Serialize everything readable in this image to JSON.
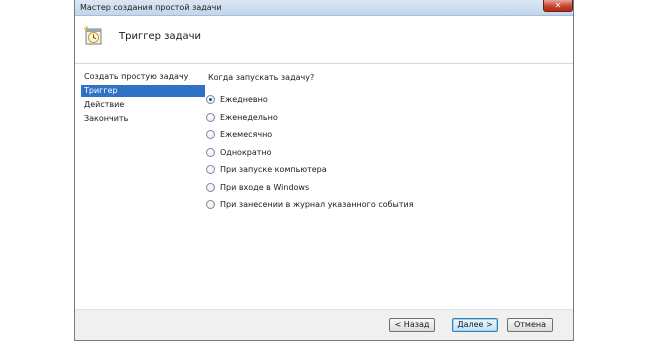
{
  "window": {
    "title": "Мастер создания простой задачи",
    "close_glyph": "✕"
  },
  "header": {
    "title": "Триггер задачи",
    "icon": "calendar-clock-icon"
  },
  "steps": [
    {
      "label": "Создать простую задачу",
      "active": false
    },
    {
      "label": "Триггер",
      "active": true
    },
    {
      "label": "Действие",
      "active": false
    },
    {
      "label": "Закончить",
      "active": false
    }
  ],
  "question": "Когда запускать задачу?",
  "options": [
    {
      "label": "Ежедневно",
      "checked": true
    },
    {
      "label": "Еженедельно",
      "checked": false
    },
    {
      "label": "Ежемесячно",
      "checked": false
    },
    {
      "label": "Однократно",
      "checked": false
    },
    {
      "label": "При запуске компьютера",
      "checked": false
    },
    {
      "label": "При входе в Windows",
      "checked": false
    },
    {
      "label": "При занесении в журнал указанного события",
      "checked": false
    }
  ],
  "buttons": {
    "back": "< Назад",
    "next": "Далее >",
    "cancel": "Отмена"
  },
  "colors": {
    "selection": "#3072c4",
    "close_button": "#c7452f"
  }
}
